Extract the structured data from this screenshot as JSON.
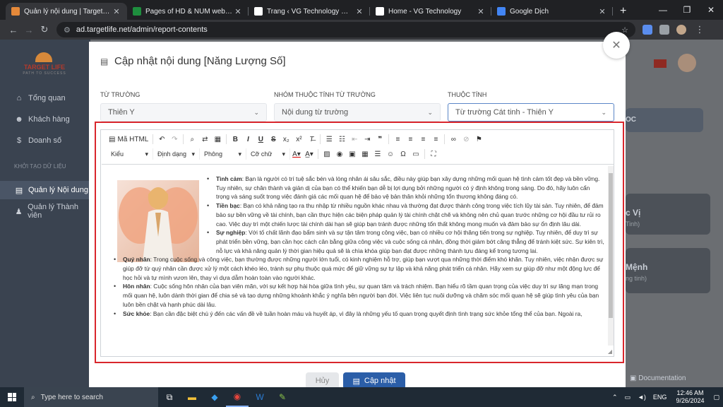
{
  "browser": {
    "tabs": [
      {
        "label": "Quản lý nội dung | Target Life",
        "favicon_color": "#e5893a",
        "active": true
      },
      {
        "label": "Pages of HD & NUM web - Goo",
        "favicon_color": "#1e8e3e",
        "active": false
      },
      {
        "label": "Trang ‹ VG Technology — Wor",
        "favicon_color": "#ffffff",
        "active": false
      },
      {
        "label": "Home - VG Technology",
        "favicon_color": "#ffffff",
        "active": false
      },
      {
        "label": "Google Dịch",
        "favicon_color": "#4285f4",
        "active": false
      }
    ],
    "url": "ad.targetlife.net/admin/report-contents",
    "new_tab": "+"
  },
  "sidebar": {
    "brand": "TARGET LIFE",
    "slogan": "PATH TO SUCCESS",
    "items": [
      {
        "label": "Tổng quan",
        "icon": "home-icon",
        "glyph": "⌂"
      },
      {
        "label": "Khách hàng",
        "icon": "users-icon",
        "glyph": "☻"
      },
      {
        "label": "Doanh số",
        "icon": "dollar-icon",
        "glyph": "$"
      }
    ],
    "section": "KHỞI TẠO DỮ LIỆU",
    "items2": [
      {
        "label": "Quản lý Nội dung",
        "icon": "book-icon",
        "glyph": "▤",
        "active": true
      },
      {
        "label": "Quản lý Thành viên",
        "icon": "member-icon",
        "glyph": "♟"
      }
    ]
  },
  "background": {
    "card_header": "OC",
    "card1_title": "c Vị",
    "card1_sub": "Tinh)",
    "card2_title": "Mệnh",
    "card2_sub": "ng tinh)",
    "docs": "Documentation"
  },
  "modal": {
    "title": "Cập nhật nội dung [Năng Lượng Số]",
    "fields": [
      {
        "label": "TỪ TRƯỜNG",
        "value": "Thiên Y"
      },
      {
        "label": "NHÓM THUỘC TÍNH TỪ TRƯỜNG",
        "value": "Nội dung từ trường"
      },
      {
        "label": "THUỘC TÍNH",
        "value": "Từ trường Cát tinh - Thiên Y"
      }
    ],
    "toolbar": {
      "source": "Mã HTML",
      "dropdowns": [
        "Kiểu",
        "Định dạng",
        "Phông",
        "Cỡ chữ"
      ]
    },
    "content": [
      {
        "title": "Tình cảm",
        "text": ": Bạn là người có trí tuệ sắc bén và lòng nhân ái sâu sắc, điều này giúp bạn xây dựng những mối quan hệ tình cảm tốt đẹp và bền vững. Tuy nhiên, sự chân thành và giản dị của bạn có thể khiến bạn dễ bị lợi dụng bởi những người có ý định không trong sáng. Do đó, hãy luôn cẩn trọng và sáng suốt trong việc đánh giá các mối quan hệ để bảo vệ bản thân khỏi những tổn thương không đáng có."
      },
      {
        "title": "Tiền bạc",
        "text": ": Bạn có khả năng tạo ra thu nhập từ nhiều nguồn khác nhau và thường đạt được thành công trong việc tích lũy tài sản. Tuy nhiên, để đảm bảo sự bền vững về tài chính, bạn cần thực hiện các biện pháp quản lý tài chính chặt chẽ và không nên chủ quan trước những cơ hội đầu tư rủi ro cao. Việc duy trì một chiến lược tài chính dài hạn sẽ giúp bạn tránh được những tổn thất không mong muốn và đảm bảo sự ổn định lâu dài."
      },
      {
        "title": "Sự nghiệp",
        "text": ": Với tố chất lãnh đạo bẩm sinh và sự tận tâm trong công việc, bạn có nhiều cơ hội thăng tiến trong sự nghiệp. Tuy nhiên, để duy trì sự phát triển bền vững, bạn cần học cách cân bằng giữa công việc và cuộc sống cá nhân, đồng thời giảm bớt căng thẳng để tránh kiệt sức. Sự kiên trì, nỗ lực và khả năng quản lý thời gian hiệu quả sẽ là chìa khóa giúp bạn đạt được những thành tựu đáng kể trong tương lai."
      },
      {
        "title": "Quý nhân",
        "text": ": Trong cuộc sống và công việc, bạn thường được những người lớn tuổi, có kinh nghiệm hỗ trợ, giúp bạn vượt qua những thời điểm khó khăn. Tuy nhiên, việc nhận được sự giúp đỡ từ quý nhân cần được xử lý một cách khéo léo, tránh sự phụ thuộc quá mức để giữ vững sự tự lập và khả năng phát triển cá nhân. Hãy xem sự giúp đỡ như một động lực để học hỏi và tự mình vươn lên, thay vì dựa dẫm hoàn toàn vào người khác."
      },
      {
        "title": "Hôn nhân",
        "text": ": Cuộc sống hôn nhân của bạn viên mãn, với sự kết hợp hài hòa giữa tình yêu, sự quan tâm và trách nhiệm. Bạn hiểu rõ tầm quan trọng của việc duy trì sự lãng mạn trong mối quan hệ, luôn dành thời gian để chia sẻ và tạo dựng những khoảnh khắc ý nghĩa bên người bạn đời. Việc liên tục nuôi dưỡng và chăm sóc mối quan hệ sẽ giúp tình yêu của bạn luôn bền chặt và hạnh phúc dài lâu."
      },
      {
        "title": "Sức khỏe",
        "text": ": Bạn cần đặc biệt chú ý đến các vấn đề về tuần hoàn máu và huyết áp, vì đây là những yếu tố quan trọng quyết định tình trạng sức khỏe tổng thể của bạn. Ngoài ra,"
      }
    ],
    "cancel": "Hủy",
    "save": "Cập nhật"
  },
  "taskbar": {
    "search": "Type here to search",
    "lang": "ENG",
    "time": "12:46 AM",
    "date": "9/26/2024"
  },
  "colors": {
    "accent": "#2b5ea8",
    "highlight_frame": "#d9262c"
  }
}
